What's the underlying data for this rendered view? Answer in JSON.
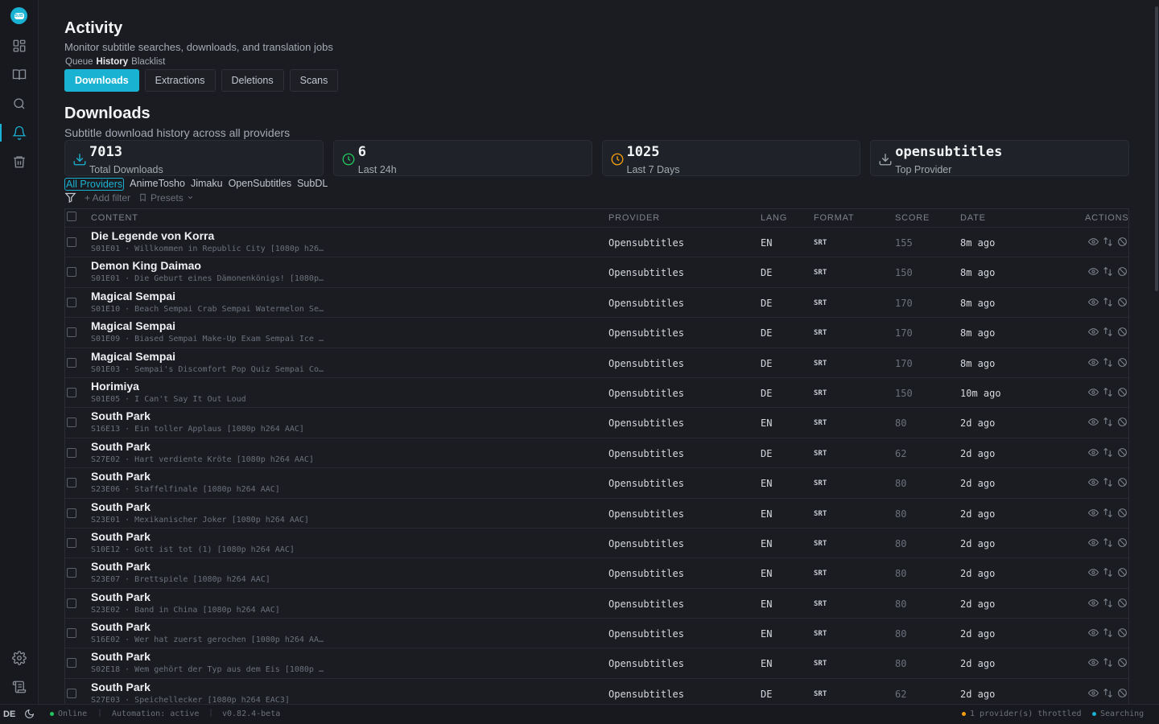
{
  "colors": {
    "accent": "#1ab2d2",
    "success": "#22c55e",
    "warning": "#f59e0b"
  },
  "sidebar": {
    "logo_text": "SUB",
    "items": [
      {
        "name": "dashboard",
        "icon": "grid-icon"
      },
      {
        "name": "library",
        "icon": "book-icon"
      },
      {
        "name": "search",
        "icon": "search-icon"
      },
      {
        "name": "activity",
        "icon": "bell-icon",
        "active": true
      },
      {
        "name": "trash",
        "icon": "trash-icon"
      }
    ],
    "bottom_items": [
      {
        "name": "settings",
        "icon": "gear-icon"
      },
      {
        "name": "logs",
        "icon": "scroll-icon"
      }
    ]
  },
  "page": {
    "title": "Activity",
    "subtitle": "Monitor subtitle searches, downloads, and translation jobs",
    "subnav": [
      "Queue",
      "History",
      "Blacklist"
    ],
    "subnav_selected": "History"
  },
  "tabs": [
    "Downloads",
    "Extractions",
    "Deletions",
    "Scans"
  ],
  "active_tab": "Downloads",
  "section": {
    "title": "Downloads",
    "subtitle": "Subtitle download history across all providers"
  },
  "stats": [
    {
      "value": "7013",
      "label": "Total Downloads",
      "icon": "download-icon"
    },
    {
      "value": "6",
      "label": "Last 24h",
      "icon": "clock-icon"
    },
    {
      "value": "1025",
      "label": "Last 7 Days",
      "icon": "clock-icon"
    },
    {
      "value": "opensubtitles",
      "label": "Top Provider",
      "icon": "download-icon"
    }
  ],
  "providers": [
    "All Providers",
    "AnimeTosho",
    "Jimaku",
    "OpenSubtitles",
    "SubDL"
  ],
  "provider_selected": "All Providers",
  "filters": {
    "add_filter": "+ Add filter",
    "presets": "Presets"
  },
  "table": {
    "columns": {
      "content": "CONTENT",
      "provider": "PROVIDER",
      "lang": "LANG",
      "format": "FORMAT",
      "score": "SCORE",
      "date": "DATE",
      "actions": "ACTIONS"
    },
    "rows": [
      {
        "title": "Die Legende von Korra",
        "sub": "S01E01 · Willkommen in Republic City [1080p h26…",
        "provider": "Opensubtitles",
        "lang": "EN",
        "format": "SRT",
        "score": "155",
        "date": "8m ago"
      },
      {
        "title": "Demon King Daimao",
        "sub": "S01E01 · Die Geburt eines Dämonenkönigs! [1080p…",
        "provider": "Opensubtitles",
        "lang": "DE",
        "format": "SRT",
        "score": "150",
        "date": "8m ago"
      },
      {
        "title": "Magical Sempai",
        "sub": "S01E10 · Beach Sempai Crab Sempai Watermelon Se…",
        "provider": "Opensubtitles",
        "lang": "DE",
        "format": "SRT",
        "score": "170",
        "date": "8m ago"
      },
      {
        "title": "Magical Sempai",
        "sub": "S01E09 · Biased Sempai Make-Up Exam Sempai Ice …",
        "provider": "Opensubtitles",
        "lang": "DE",
        "format": "SRT",
        "score": "170",
        "date": "8m ago"
      },
      {
        "title": "Magical Sempai",
        "sub": "S01E03 · Sempai's Discomfort Pop Quiz Sempai Co…",
        "provider": "Opensubtitles",
        "lang": "DE",
        "format": "SRT",
        "score": "170",
        "date": "8m ago"
      },
      {
        "title": "Horimiya",
        "sub": "S01E05 · I Can't Say It Out Loud",
        "provider": "Opensubtitles",
        "lang": "DE",
        "format": "SRT",
        "score": "150",
        "date": "10m ago"
      },
      {
        "title": "South Park",
        "sub": "S16E13 · Ein toller Applaus [1080p h264 AAC]",
        "provider": "Opensubtitles",
        "lang": "EN",
        "format": "SRT",
        "score": "80",
        "date": "2d ago"
      },
      {
        "title": "South Park",
        "sub": "S27E02 · Hart verdiente Kröte [1080p h264 AAC]",
        "provider": "Opensubtitles",
        "lang": "DE",
        "format": "SRT",
        "score": "62",
        "date": "2d ago"
      },
      {
        "title": "South Park",
        "sub": "S23E06 · Staffelfinale [1080p h264 AAC]",
        "provider": "Opensubtitles",
        "lang": "EN",
        "format": "SRT",
        "score": "80",
        "date": "2d ago"
      },
      {
        "title": "South Park",
        "sub": "S23E01 · Mexikanischer Joker [1080p h264 AAC]",
        "provider": "Opensubtitles",
        "lang": "EN",
        "format": "SRT",
        "score": "80",
        "date": "2d ago"
      },
      {
        "title": "South Park",
        "sub": "S10E12 · Gott ist tot (1) [1080p h264 AAC]",
        "provider": "Opensubtitles",
        "lang": "EN",
        "format": "SRT",
        "score": "80",
        "date": "2d ago"
      },
      {
        "title": "South Park",
        "sub": "S23E07 · Brettspiele [1080p h264 AAC]",
        "provider": "Opensubtitles",
        "lang": "EN",
        "format": "SRT",
        "score": "80",
        "date": "2d ago"
      },
      {
        "title": "South Park",
        "sub": "S23E02 · Band in China [1080p h264 AAC]",
        "provider": "Opensubtitles",
        "lang": "EN",
        "format": "SRT",
        "score": "80",
        "date": "2d ago"
      },
      {
        "title": "South Park",
        "sub": "S16E02 · Wer hat zuerst gerochen [1080p h264 AA…",
        "provider": "Opensubtitles",
        "lang": "EN",
        "format": "SRT",
        "score": "80",
        "date": "2d ago"
      },
      {
        "title": "South Park",
        "sub": "S02E18 · Wem gehört der Typ aus dem Eis [1080p …",
        "provider": "Opensubtitles",
        "lang": "EN",
        "format": "SRT",
        "score": "80",
        "date": "2d ago"
      },
      {
        "title": "South Park",
        "sub": "S27E03 · Speichellecker [1080p h264 EAC3]",
        "provider": "Opensubtitles",
        "lang": "DE",
        "format": "SRT",
        "score": "62",
        "date": "2d ago"
      }
    ]
  },
  "statusbar": {
    "lang": "DE",
    "online": "Online",
    "automation": "Automation: active",
    "version": "v0.82.4-beta",
    "throttled": "1 provider(s) throttled",
    "searching": "Searching"
  }
}
